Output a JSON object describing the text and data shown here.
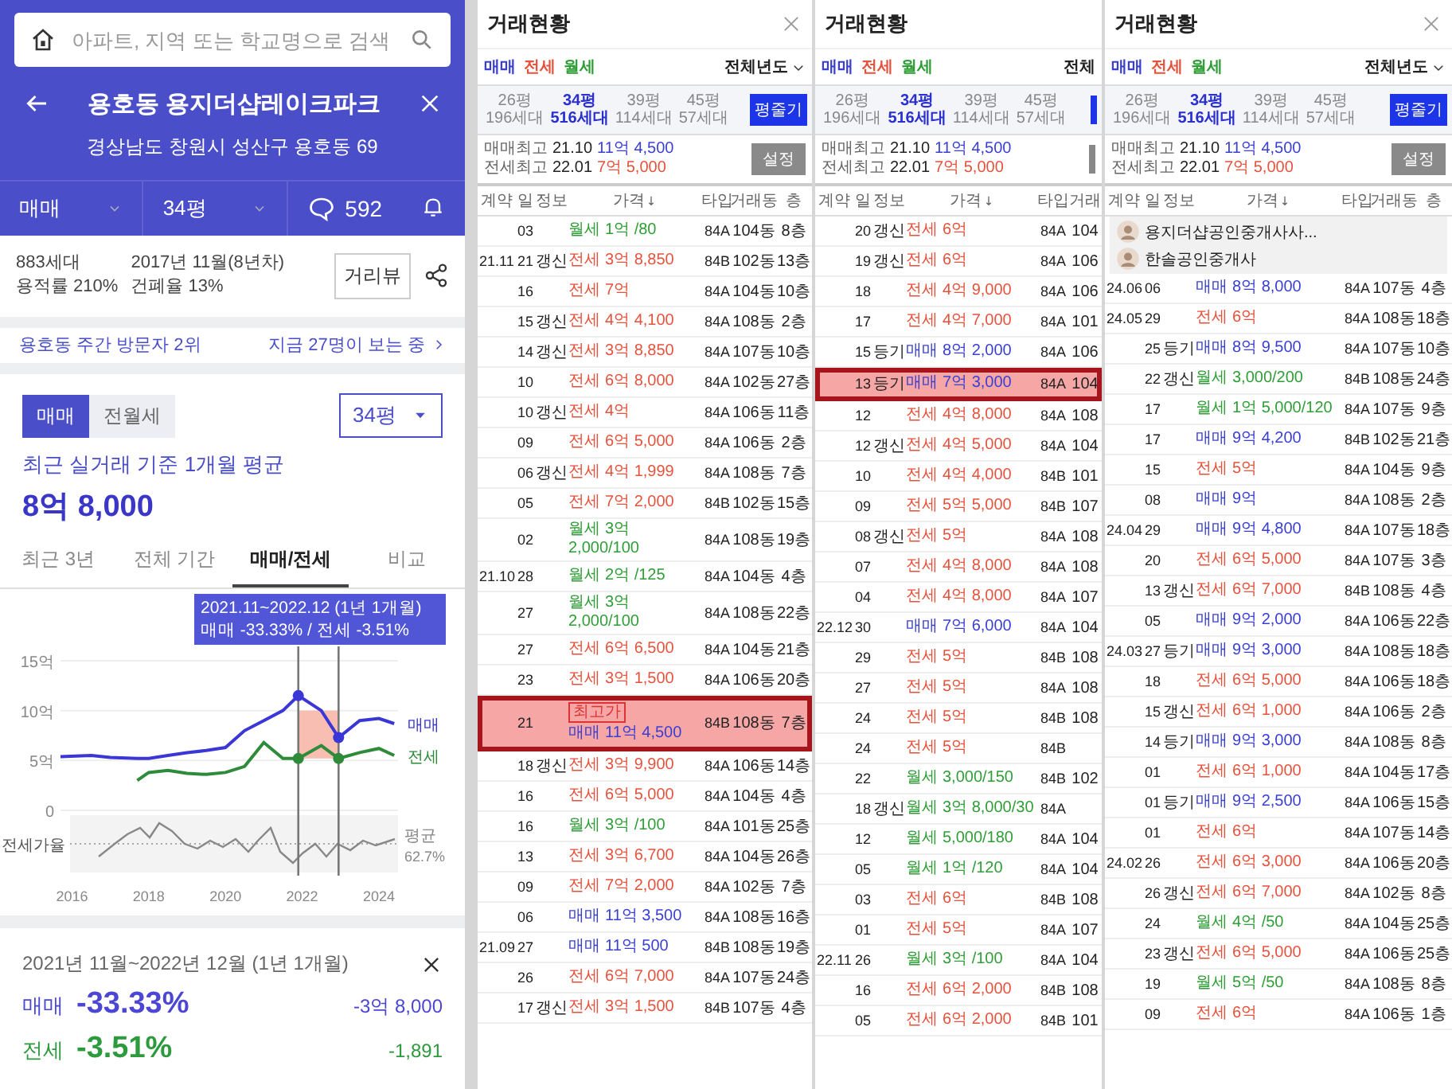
{
  "detail": {
    "search": {
      "placeholder": "아파트, 지역 또는 학교명으로 검색"
    },
    "header": {
      "title": "용호동 용지더샵레이크파크",
      "address": "경상남도 창원시 성산구 용호동 69"
    },
    "filter_bar": {
      "deal": "매매",
      "size": "34평",
      "comments": "592"
    },
    "info": {
      "households": "883세대",
      "floor_area_ratio": "용적률 210%",
      "built": "2017년 11월(8년차)",
      "coverage_ratio": "건폐율 13%",
      "street_view": "거리뷰"
    },
    "visitors": {
      "rank": "용호동 주간 방문자 2위",
      "watching": "지금 27명이 보는 중"
    },
    "deal_tabs": [
      {
        "label": "매매",
        "selected": true
      },
      {
        "label": "전월세",
        "selected": false
      }
    ],
    "size_select": "34평",
    "average": {
      "caption": "최근 실거래 기준 1개월 평균",
      "value": "8억 8,000"
    },
    "period_tabs": [
      {
        "label": "최근 3년",
        "selected": false
      },
      {
        "label": "전체 기간",
        "selected": false
      },
      {
        "label": "매매/전세",
        "selected": true
      },
      {
        "label": "비교",
        "selected": false
      }
    ],
    "chart": {
      "tooltip": [
        "2021.11~2022.12 (1년 1개월)",
        "매매 -33.33%  /  전세 -3.51%"
      ],
      "ratio_label": "전세가율",
      "avg_label": "평균",
      "avg_value": "62.7%",
      "chart_data": {
        "type": "line",
        "x": [
          2015.7,
          2016.5,
          2017,
          2017.7,
          2018,
          2018.5,
          2019,
          2019.5,
          2020,
          2020.5,
          2021,
          2021.5,
          2021.9,
          2022.5,
          2022.95,
          2023.5,
          2024,
          2024.4
        ],
        "series": [
          {
            "name": "매매",
            "color": "#3b36d6",
            "values": [
              5.4,
              5.5,
              5.3,
              5.2,
              5.2,
              5.5,
              5.8,
              6.0,
              6.3,
              8.0,
              9.0,
              10.0,
              11.5,
              10.0,
              7.3,
              9.0,
              9.2,
              8.7
            ]
          },
          {
            "name": "전세",
            "color": "#2e8b3a",
            "values": [
              null,
              null,
              null,
              3.0,
              3.8,
              4.0,
              3.7,
              3.6,
              3.8,
              4.4,
              6.8,
              5.2,
              5.2,
              6.5,
              5.2,
              5.8,
              6.2,
              5.5
            ]
          }
        ],
        "xlim": [
          2015.7,
          2024.5
        ],
        "ylim": [
          0,
          15
        ],
        "xticks": [
          2016,
          2018,
          2020,
          2022,
          2024
        ],
        "yticks": [
          {
            "value": 0,
            "label": "0"
          },
          {
            "value": 5,
            "label": "5억"
          },
          {
            "value": 10,
            "label": "10억"
          },
          {
            "value": 15,
            "label": "15억"
          }
        ],
        "ref_lines": [
          {
            "axis": "x",
            "value": 2021.9
          },
          {
            "axis": "x",
            "value": 2022.95
          }
        ],
        "bands": [
          {
            "axis": "x",
            "from": 2021.9,
            "to": 2022.95
          }
        ]
      }
    },
    "summary": {
      "period": "2021년 11월~2022년 12월 (1년 1개월)",
      "rows": [
        {
          "label": "매매",
          "change": "-33.33%",
          "amount": "-3억 8,000",
          "color": "#4b46d4"
        },
        {
          "label": "전세",
          "change": "-3.51%",
          "amount": "-1,891",
          "color": "#2e9a3e"
        }
      ]
    }
  },
  "panels": [
    {
      "kind": "full",
      "title": "거래현황",
      "legend": [
        {
          "label": "매매",
          "color": "#3a3fd4"
        },
        {
          "label": "전세",
          "color": "#e5533d"
        },
        {
          "label": "월세",
          "color": "#2f9e36"
        }
      ],
      "year_filter": "전체년도",
      "size_tabs": [
        {
          "size": "26평",
          "units": "196세대",
          "selected": false
        },
        {
          "size": "34평",
          "units": "516세대",
          "selected": true
        },
        {
          "size": "39평",
          "units": "114세대",
          "selected": false
        },
        {
          "size": "45평",
          "units": "57세대",
          "selected": false
        }
      ],
      "size_button": "평줄기",
      "highs": [
        {
          "label": "매매최고",
          "date": "21.10",
          "value": "11억 4,500",
          "color": "#3a3fd4"
        },
        {
          "label": "전세최고",
          "date": "22.01",
          "value": "7억 5,000",
          "color": "#e5533d"
        }
      ],
      "settings_button": "설정",
      "columns": [
        "계약",
        "일",
        "정보",
        "가격",
        "타입",
        "거래동",
        "층"
      ],
      "rows": [
        {
          "day": "03",
          "deal": "월세",
          "price": "1억 /80",
          "type": "84A",
          "building": "104동",
          "floor": "8층",
          "color": "#2f9e36",
          "highlighted": false
        },
        {
          "month": "21.11",
          "day": "21",
          "info": "갱신",
          "deal": "전세",
          "price": "3억 8,850",
          "type": "84B",
          "building": "102동",
          "floor": "13층",
          "color": "#e5533d",
          "highlighted": false
        },
        {
          "day": "16",
          "deal": "전세",
          "price": "7억",
          "type": "84A",
          "building": "104동",
          "floor": "10층",
          "color": "#e5533d",
          "highlighted": false
        },
        {
          "day": "15",
          "info": "갱신",
          "deal": "전세",
          "price": "4억 4,100",
          "type": "84A",
          "building": "108동",
          "floor": "2층",
          "color": "#e5533d",
          "highlighted": false
        },
        {
          "day": "14",
          "info": "갱신",
          "deal": "전세",
          "price": "3억 8,850",
          "type": "84A",
          "building": "107동",
          "floor": "10층",
          "color": "#e5533d",
          "highlighted": false
        },
        {
          "day": "10",
          "deal": "전세",
          "price": "6억 8,000",
          "type": "84A",
          "building": "102동",
          "floor": "27층",
          "color": "#e5533d",
          "highlighted": false
        },
        {
          "day": "10",
          "info": "갱신",
          "deal": "전세",
          "price": "4억",
          "type": "84A",
          "building": "106동",
          "floor": "11층",
          "color": "#e5533d",
          "highlighted": false
        },
        {
          "day": "09",
          "deal": "전세",
          "price": "6억 5,000",
          "type": "84A",
          "building": "106동",
          "floor": "2층",
          "color": "#e5533d",
          "highlighted": false
        },
        {
          "day": "06",
          "info": "갱신",
          "deal": "전세",
          "price": "4억 1,999",
          "type": "84A",
          "building": "108동",
          "floor": "7층",
          "color": "#e5533d",
          "highlighted": false
        },
        {
          "day": "05",
          "deal": "전세",
          "price": "7억 2,000",
          "type": "84B",
          "building": "102동",
          "floor": "15층",
          "color": "#e5533d",
          "highlighted": false
        },
        {
          "day": "02",
          "deal": "월세",
          "price": "3억 2,000/100",
          "type": "84A",
          "building": "108동",
          "floor": "19층",
          "color": "#2f9e36",
          "highlighted": false
        },
        {
          "month": "21.10",
          "day": "28",
          "deal": "월세",
          "price": "2억 /125",
          "type": "84A",
          "building": "104동",
          "floor": "4층",
          "color": "#2f9e36",
          "highlighted": false
        },
        {
          "day": "27",
          "deal": "월세",
          "price": "3억 2,000/100",
          "type": "84A",
          "building": "108동",
          "floor": "22층",
          "color": "#2f9e36",
          "highlighted": false
        },
        {
          "day": "27",
          "deal": "전세",
          "price": "6억 6,500",
          "type": "84A",
          "building": "104동",
          "floor": "21층",
          "color": "#e5533d",
          "highlighted": false
        },
        {
          "day": "23",
          "deal": "전세",
          "price": "3억 1,500",
          "type": "84A",
          "building": "106동",
          "floor": "20층",
          "color": "#e5533d",
          "highlighted": false
        },
        {
          "day": "21",
          "badge": "최고가",
          "deal": "매매",
          "price": "11억 4,500",
          "type": "84B",
          "building": "108동",
          "floor": "7층",
          "color": "#3a3fd4",
          "highlighted": true
        },
        {
          "day": "18",
          "info": "갱신",
          "deal": "전세",
          "price": "3억 9,900",
          "type": "84A",
          "building": "106동",
          "floor": "14층",
          "color": "#e5533d",
          "highlighted": false
        },
        {
          "day": "16",
          "deal": "전세",
          "price": "6억 5,000",
          "type": "84A",
          "building": "104동",
          "floor": "4층",
          "color": "#e5533d",
          "highlighted": false
        },
        {
          "day": "16",
          "deal": "월세",
          "price": "3억 /100",
          "type": "84A",
          "building": "101동",
          "floor": "25층",
          "color": "#2f9e36",
          "highlighted": false
        },
        {
          "day": "13",
          "deal": "전세",
          "price": "3억 6,700",
          "type": "84A",
          "building": "104동",
          "floor": "26층",
          "color": "#e5533d",
          "highlighted": false
        },
        {
          "day": "09",
          "deal": "전세",
          "price": "7억 2,000",
          "type": "84A",
          "building": "102동",
          "floor": "7층",
          "color": "#e5533d",
          "highlighted": false
        },
        {
          "day": "06",
          "deal": "매매",
          "price": "11억 3,500",
          "type": "84A",
          "building": "108동",
          "floor": "16층",
          "color": "#3a3fd4",
          "highlighted": false
        },
        {
          "month": "21.09",
          "day": "27",
          "deal": "매매",
          "price": "11억 500",
          "type": "84B",
          "building": "108동",
          "floor": "19층",
          "color": "#3a3fd4",
          "highlighted": false
        },
        {
          "day": "26",
          "deal": "전세",
          "price": "6억 7,000",
          "type": "84A",
          "building": "107동",
          "floor": "24층",
          "color": "#e5533d",
          "highlighted": false
        },
        {
          "day": "17",
          "info": "갱신",
          "deal": "전세",
          "price": "3억 1,500",
          "type": "84B",
          "building": "107동",
          "floor": "4층",
          "color": "#e5533d",
          "highlighted": false
        }
      ]
    },
    {
      "kind": "cropped",
      "title": "거래현황",
      "legend": [
        {
          "label": "매매",
          "color": "#3a3fd4"
        },
        {
          "label": "전세",
          "color": "#e5533d"
        },
        {
          "label": "월세",
          "color": "#2f9e36"
        }
      ],
      "year_filter": "전체",
      "size_tabs": [
        {
          "size": "26평",
          "units": "196세대",
          "selected": false
        },
        {
          "size": "34평",
          "units": "516세대",
          "selected": true
        },
        {
          "size": "39평",
          "units": "114세대",
          "selected": false
        },
        {
          "size": "45평",
          "units": "57세대",
          "selected": false
        }
      ],
      "highs": [
        {
          "label": "매매최고",
          "date": "21.10",
          "value": "11억 4,500",
          "color": "#3a3fd4"
        },
        {
          "label": "전세최고",
          "date": "22.01",
          "value": "7억 5,000",
          "color": "#e5533d"
        }
      ],
      "columns": [
        "계약",
        "일",
        "정보",
        "가격",
        "타입",
        "거래"
      ],
      "rows": [
        {
          "day": "20",
          "info": "갱신",
          "deal": "전세",
          "price": "6억",
          "type": "84A",
          "building": "104",
          "color": "#e5533d",
          "highlighted": false
        },
        {
          "day": "19",
          "info": "갱신",
          "deal": "전세",
          "price": "6억",
          "type": "84A",
          "building": "106",
          "color": "#e5533d",
          "highlighted": false
        },
        {
          "day": "18",
          "deal": "전세",
          "price": "4억 9,000",
          "type": "84A",
          "building": "106",
          "color": "#e5533d",
          "highlighted": false
        },
        {
          "day": "17",
          "deal": "전세",
          "price": "4억 7,000",
          "type": "84A",
          "building": "101",
          "color": "#e5533d",
          "highlighted": false
        },
        {
          "day": "15",
          "info": "등기",
          "deal": "매매",
          "price": "8억 2,000",
          "type": "84A",
          "building": "106",
          "color": "#3a3fd4",
          "highlighted": false
        },
        {
          "day": "13",
          "info": "등기",
          "deal": "매매",
          "price": "7억 3,000",
          "type": "84A",
          "building": "104",
          "color": "#3a3fd4",
          "highlighted": true
        },
        {
          "day": "12",
          "deal": "전세",
          "price": "4억 8,000",
          "type": "84A",
          "building": "108",
          "color": "#e5533d",
          "highlighted": false
        },
        {
          "day": "12",
          "info": "갱신",
          "deal": "전세",
          "price": "4억 5,000",
          "type": "84A",
          "building": "104",
          "color": "#e5533d",
          "highlighted": false
        },
        {
          "day": "10",
          "deal": "전세",
          "price": "4억 4,000",
          "type": "84B",
          "building": "101",
          "color": "#e5533d",
          "highlighted": false
        },
        {
          "day": "09",
          "deal": "전세",
          "price": "5억 5,000",
          "type": "84B",
          "building": "107",
          "color": "#e5533d",
          "highlighted": false
        },
        {
          "day": "08",
          "info": "갱신",
          "deal": "전세",
          "price": "5억",
          "type": "84A",
          "building": "108",
          "color": "#e5533d",
          "highlighted": false
        },
        {
          "day": "07",
          "deal": "전세",
          "price": "4억 8,000",
          "type": "84A",
          "building": "108",
          "color": "#e5533d",
          "highlighted": false
        },
        {
          "day": "04",
          "deal": "전세",
          "price": "4억 8,000",
          "type": "84A",
          "building": "107",
          "color": "#e5533d",
          "highlighted": false
        },
        {
          "month": "22.12",
          "day": "30",
          "deal": "매매",
          "price": "7억 6,000",
          "type": "84A",
          "building": "104",
          "color": "#3a3fd4",
          "highlighted": false
        },
        {
          "day": "29",
          "deal": "전세",
          "price": "5억",
          "type": "84B",
          "building": "108",
          "color": "#e5533d",
          "highlighted": false
        },
        {
          "day": "27",
          "deal": "전세",
          "price": "5억",
          "type": "84A",
          "building": "108",
          "color": "#e5533d",
          "highlighted": false
        },
        {
          "day": "24",
          "deal": "전세",
          "price": "5억",
          "type": "84B",
          "building": "108",
          "color": "#e5533d",
          "highlighted": false
        },
        {
          "day": "24",
          "deal": "전세",
          "price": "5억",
          "type": "84B",
          "color": "#e5533d",
          "highlighted": false
        },
        {
          "day": "22",
          "deal": "월세",
          "price": "3,000/150",
          "type": "84B",
          "building": "102",
          "color": "#2f9e36",
          "highlighted": false
        },
        {
          "day": "18",
          "info": "갱신",
          "deal": "월세",
          "price": "3억 8,000/30",
          "type": "84A",
          "color": "#2f9e36",
          "highlighted": false
        },
        {
          "day": "12",
          "deal": "월세",
          "price": "5,000/180",
          "type": "84A",
          "building": "104",
          "color": "#2f9e36",
          "highlighted": false
        },
        {
          "day": "05",
          "deal": "월세",
          "price": "1억 /120",
          "type": "84A",
          "building": "104",
          "color": "#2f9e36",
          "highlighted": false
        },
        {
          "day": "03",
          "deal": "전세",
          "price": "6억",
          "type": "84B",
          "building": "108",
          "color": "#e5533d",
          "highlighted": false
        },
        {
          "day": "01",
          "deal": "전세",
          "price": "5억",
          "type": "84A",
          "building": "107",
          "color": "#e5533d",
          "highlighted": false
        },
        {
          "month": "22.11",
          "day": "26",
          "deal": "월세",
          "price": "3억 /100",
          "type": "84A",
          "building": "104",
          "color": "#2f9e36",
          "highlighted": false
        },
        {
          "day": "16",
          "deal": "전세",
          "price": "6억 2,000",
          "type": "84B",
          "building": "108",
          "color": "#e5533d",
          "highlighted": false
        },
        {
          "day": "05",
          "deal": "전세",
          "price": "6억 2,000",
          "type": "84B",
          "building": "101",
          "color": "#e5533d",
          "highlighted": false
        }
      ]
    },
    {
      "kind": "full",
      "title": "거래현황",
      "legend": [
        {
          "label": "매매",
          "color": "#3a3fd4"
        },
        {
          "label": "전세",
          "color": "#e5533d"
        },
        {
          "label": "월세",
          "color": "#2f9e36"
        }
      ],
      "year_filter": "전체년도",
      "size_tabs": [
        {
          "size": "26평",
          "units": "196세대",
          "selected": false
        },
        {
          "size": "34평",
          "units": "516세대",
          "selected": true
        },
        {
          "size": "39평",
          "units": "114세대",
          "selected": false
        },
        {
          "size": "45평",
          "units": "57세대",
          "selected": false
        }
      ],
      "size_button": "평줄기",
      "highs": [
        {
          "label": "매매최고",
          "date": "21.10",
          "value": "11억 4,500",
          "color": "#3a3fd4"
        },
        {
          "label": "전세최고",
          "date": "22.01",
          "value": "7억 5,000",
          "color": "#e5533d"
        }
      ],
      "settings_button": "설정",
      "columns": [
        "계약",
        "일",
        "정보",
        "가격",
        "타입",
        "거래동",
        "층"
      ],
      "brokers": [
        {
          "name": "용지더샵공인중개사사..."
        },
        {
          "name": "한솔공인중개사"
        }
      ],
      "rows": [
        {
          "month": "24.06",
          "day": "06",
          "deal": "매매",
          "price": "8억 8,000",
          "type": "84A",
          "building": "107동",
          "floor": "4층",
          "color": "#3a3fd4",
          "highlighted": false
        },
        {
          "month": "24.05",
          "day": "29",
          "deal": "전세",
          "price": "6억",
          "type": "84A",
          "building": "108동",
          "floor": "18층",
          "color": "#e5533d",
          "highlighted": false
        },
        {
          "day": "25",
          "info": "등기",
          "deal": "매매",
          "price": "8억 9,500",
          "type": "84A",
          "building": "107동",
          "floor": "10층",
          "color": "#3a3fd4",
          "highlighted": false
        },
        {
          "day": "22",
          "info": "갱신",
          "deal": "월세",
          "price": "3,000/200",
          "type": "84B",
          "building": "108동",
          "floor": "24층",
          "color": "#2f9e36",
          "highlighted": false
        },
        {
          "day": "17",
          "deal": "월세",
          "price": "1억 5,000/120",
          "type": "84A",
          "building": "107동",
          "floor": "9층",
          "color": "#2f9e36",
          "highlighted": false
        },
        {
          "day": "17",
          "deal": "매매",
          "price": "9억 4,200",
          "type": "84B",
          "building": "102동",
          "floor": "21층",
          "color": "#3a3fd4",
          "highlighted": false
        },
        {
          "day": "15",
          "deal": "전세",
          "price": "5억",
          "type": "84A",
          "building": "104동",
          "floor": "9층",
          "color": "#e5533d",
          "highlighted": false
        },
        {
          "day": "08",
          "deal": "매매",
          "price": "9억",
          "type": "84A",
          "building": "108동",
          "floor": "2층",
          "color": "#3a3fd4",
          "highlighted": false
        },
        {
          "month": "24.04",
          "day": "29",
          "deal": "매매",
          "price": "9억 4,800",
          "type": "84A",
          "building": "107동",
          "floor": "18층",
          "color": "#3a3fd4",
          "highlighted": false
        },
        {
          "day": "20",
          "deal": "전세",
          "price": "6억 5,000",
          "type": "84A",
          "building": "107동",
          "floor": "3층",
          "color": "#e5533d",
          "highlighted": false
        },
        {
          "day": "13",
          "info": "갱신",
          "deal": "전세",
          "price": "6억 7,000",
          "type": "84B",
          "building": "108동",
          "floor": "4층",
          "color": "#e5533d",
          "highlighted": false
        },
        {
          "day": "05",
          "deal": "매매",
          "price": "9억 2,000",
          "type": "84A",
          "building": "106동",
          "floor": "22층",
          "color": "#3a3fd4",
          "highlighted": false
        },
        {
          "month": "24.03",
          "day": "27",
          "info": "등기",
          "deal": "매매",
          "price": "9억 3,000",
          "type": "84A",
          "building": "108동",
          "floor": "18층",
          "color": "#3a3fd4",
          "highlighted": false
        },
        {
          "day": "18",
          "deal": "전세",
          "price": "6억 5,000",
          "type": "84A",
          "building": "106동",
          "floor": "18층",
          "color": "#e5533d",
          "highlighted": false
        },
        {
          "day": "15",
          "info": "갱신",
          "deal": "전세",
          "price": "6억 1,000",
          "type": "84A",
          "building": "106동",
          "floor": "2층",
          "color": "#e5533d",
          "highlighted": false
        },
        {
          "day": "14",
          "info": "등기",
          "deal": "매매",
          "price": "9억 3,000",
          "type": "84A",
          "building": "108동",
          "floor": "8층",
          "color": "#3a3fd4",
          "highlighted": false
        },
        {
          "day": "01",
          "deal": "전세",
          "price": "6억 1,000",
          "type": "84A",
          "building": "104동",
          "floor": "17층",
          "color": "#e5533d",
          "highlighted": false
        },
        {
          "day": "01",
          "info": "등기",
          "deal": "매매",
          "price": "9억 2,500",
          "type": "84A",
          "building": "106동",
          "floor": "15층",
          "color": "#3a3fd4",
          "highlighted": false
        },
        {
          "day": "01",
          "deal": "전세",
          "price": "6억",
          "type": "84A",
          "building": "107동",
          "floor": "14층",
          "color": "#e5533d",
          "highlighted": false
        },
        {
          "month": "24.02",
          "day": "26",
          "deal": "전세",
          "price": "6억 3,000",
          "type": "84A",
          "building": "106동",
          "floor": "20층",
          "color": "#e5533d",
          "highlighted": false
        },
        {
          "day": "26",
          "info": "갱신",
          "deal": "전세",
          "price": "6억 7,000",
          "type": "84A",
          "building": "102동",
          "floor": "8층",
          "color": "#e5533d",
          "highlighted": false
        },
        {
          "day": "24",
          "deal": "월세",
          "price": "4억 /50",
          "type": "84A",
          "building": "104동",
          "floor": "25층",
          "color": "#2f9e36",
          "highlighted": false
        },
        {
          "day": "23",
          "info": "갱신",
          "deal": "전세",
          "price": "6억 5,000",
          "type": "84A",
          "building": "106동",
          "floor": "25층",
          "color": "#e5533d",
          "highlighted": false
        },
        {
          "day": "19",
          "deal": "월세",
          "price": "5억 /50",
          "type": "84A",
          "building": "108동",
          "floor": "8층",
          "color": "#2f9e36",
          "highlighted": false
        },
        {
          "day": "09",
          "deal": "전세",
          "price": "6억",
          "type": "84A",
          "building": "106동",
          "floor": "1층",
          "color": "#e5533d",
          "highlighted": false
        }
      ]
    }
  ]
}
